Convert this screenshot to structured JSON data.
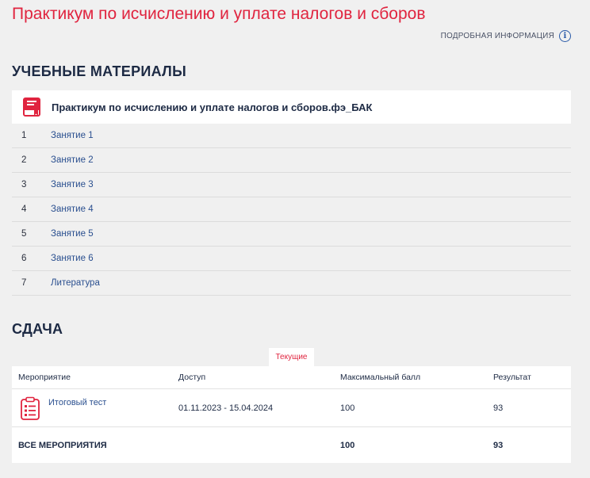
{
  "page": {
    "title": "Практикум по исчислению и уплате налогов и сборов",
    "more_info": "ПОДРОБНАЯ ИНФОРМАЦИЯ",
    "info_glyph": "i"
  },
  "materials": {
    "heading": "УЧЕБНЫЕ МАТЕРИАЛЫ",
    "card_title": "Практикум по исчислению и уплате налогов и сборов.фэ_БАК",
    "lessons": [
      {
        "num": "1",
        "label": "Занятие 1"
      },
      {
        "num": "2",
        "label": "Занятие 2"
      },
      {
        "num": "3",
        "label": "Занятие 3"
      },
      {
        "num": "4",
        "label": "Занятие 4"
      },
      {
        "num": "5",
        "label": "Занятие 5"
      },
      {
        "num": "6",
        "label": "Занятие 6"
      },
      {
        "num": "7",
        "label": "Литература"
      }
    ]
  },
  "exam": {
    "heading": "СДАЧА",
    "tab_current": "Текущие",
    "columns": [
      "Мероприятие",
      "Доступ",
      "Максимальный балл",
      "Результат"
    ],
    "rows": [
      {
        "name": "Итоговый тест",
        "access": "01.11.2023 - 15.04.2024",
        "max": "100",
        "result": "93"
      }
    ],
    "total": {
      "label": "ВСЕ МЕРОПРИЯТИЯ",
      "max": "100",
      "result": "93"
    }
  },
  "colors": {
    "accent": "#e0243f",
    "navy": "#1d2a44",
    "link": "#2a4f8f",
    "background": "#f0f0f0"
  }
}
